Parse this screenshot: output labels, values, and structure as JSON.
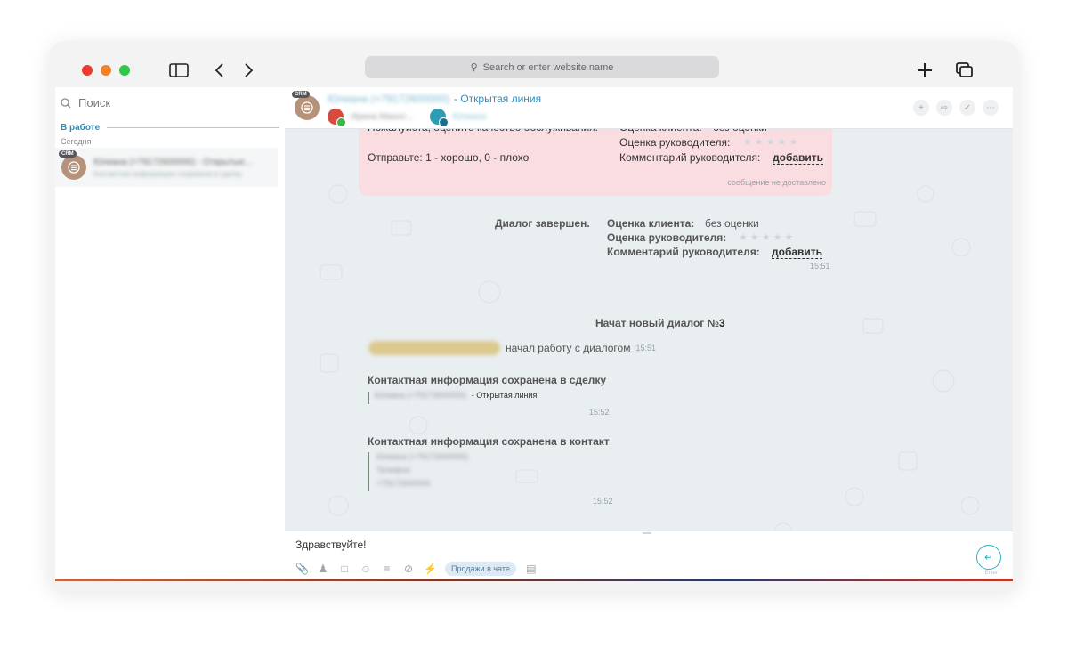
{
  "browser": {
    "address_placeholder": "Search or enter website name",
    "icons": [
      "sidebar-toggle-icon",
      "back-arrow-icon",
      "forward-arrow-icon",
      "search-icon",
      "new-tab-icon",
      "tabs-overview-icon"
    ]
  },
  "sidebar": {
    "search_placeholder": "Поиск",
    "section_label": "В работе",
    "subsection_label": "Сегодня",
    "chat_item": {
      "badge": "CRM",
      "title": "Юлиана (+79172600000) - Открытые...",
      "preview": "Контактная информация сохранена в сделку"
    }
  },
  "chat_header": {
    "badge": "CRM",
    "title_blurred": "Юлиана (+79172600000)",
    "title_suffix": "- Открытая линия",
    "operator_blurred": "Ирина Маннс...",
    "group_blurred": "Юлиана"
  },
  "pink_card": {
    "left_text_top": "Пожалуйста, оцените качество обслуживания.",
    "left_text_bottom": "Отправьте: 1 - хорошо, 0 - плохо",
    "client_rating_label": "Оценка клиента:",
    "client_rating_value": "без оценки",
    "manager_rating_label": "Оценка руководителя:",
    "manager_comment_label": "Комментарий руководителя:",
    "manager_comment_action": "добавить",
    "status": "сообщение не доставлено"
  },
  "dialog_end": {
    "label": "Диалог завершен.",
    "client_rating_label": "Оценка клиента:",
    "client_rating_value": "без оценки",
    "manager_rating_label": "Оценка руководителя:",
    "manager_comment_label": "Комментарий руководителя:",
    "manager_comment_action": "добавить",
    "time": "15:51"
  },
  "new_dialog": {
    "text": "Начат новый диалог №",
    "number": "3"
  },
  "started_work": {
    "operator_blurred": "Ирина Маннс (Тест)",
    "text": "начал работу с диалогом",
    "time": "15:51"
  },
  "deal_saved": {
    "title": "Контактная информация сохранена в сделку",
    "blurred": "Юлиана (+79172600000)",
    "suffix": "- Открытая линия",
    "time": "15:52"
  },
  "contact_saved": {
    "title": "Контактная информация сохранена в контакт",
    "blurred_lines": [
      "Юлиана (+79172600000)",
      "Телефон:",
      "+79172600000"
    ],
    "time": "15:52"
  },
  "composer": {
    "draft": "Здравствуйте!",
    "tag_pill": "Продажи в чате",
    "send_hint": "Enter"
  }
}
